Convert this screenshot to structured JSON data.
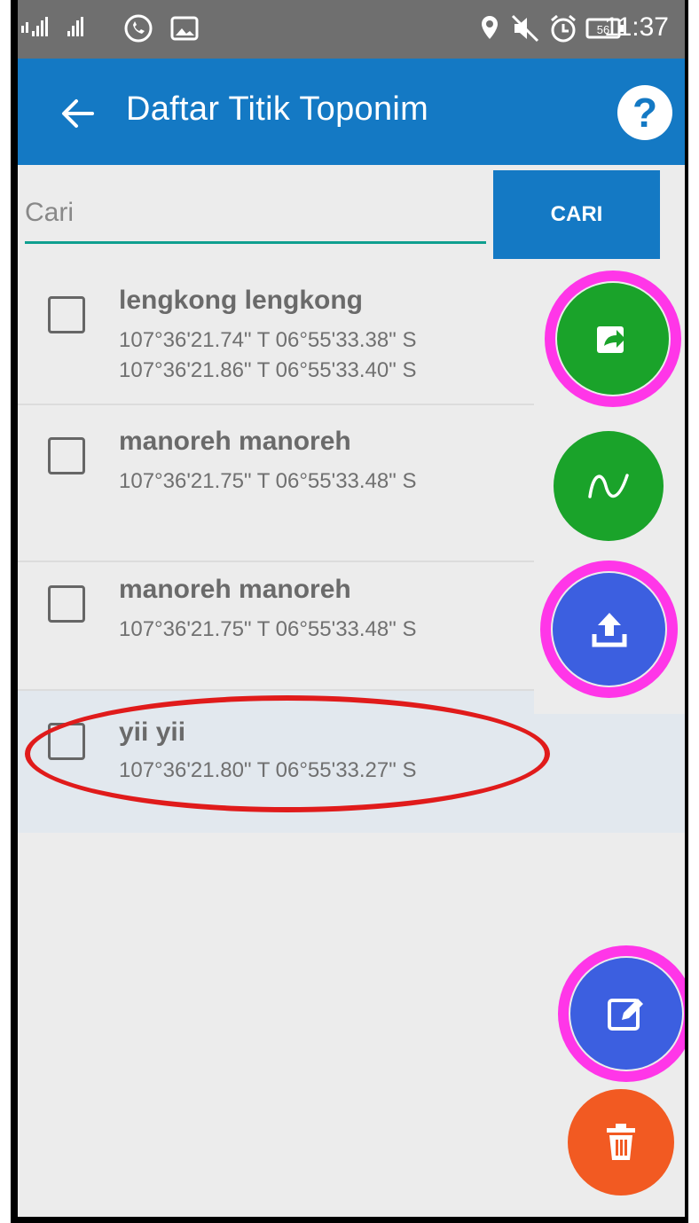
{
  "status_bar": {
    "time": "11:37",
    "icons": [
      "signal-icon",
      "whatsapp-icon",
      "gallery-icon",
      "location-icon",
      "mute-icon",
      "alarm-icon",
      "battery-icon"
    ]
  },
  "app_bar": {
    "title": "Daftar Titik Toponim",
    "help_label": "?"
  },
  "search": {
    "placeholder": "Cari",
    "button_label": "CARI"
  },
  "list": {
    "items": [
      {
        "name": "lengkong lengkong",
        "coords": [
          "107°36'21.74\" T 06°55'33.38\" S",
          "107°36'21.86\" T 06°55'33.40\" S"
        ]
      },
      {
        "name": "manoreh manoreh",
        "coords": [
          "107°36'21.75\" T 06°55'33.48\" S"
        ]
      },
      {
        "name": "manoreh manoreh",
        "coords": [
          "107°36'21.75\" T 06°55'33.48\" S"
        ]
      },
      {
        "name": "yii yii",
        "coords": [
          "107°36'21.80\" T 06°55'33.27\" S"
        ]
      }
    ]
  },
  "fabs": {
    "share_icon": "share-icon",
    "curve_icon": "curve-icon",
    "upload_icon": "upload-icon",
    "edit_icon": "edit-icon",
    "delete_icon": "trash-icon"
  },
  "colors": {
    "primary": "#1479c4",
    "green": "#1aa32a",
    "indigo": "#3c5fe0",
    "orange": "#f25a22",
    "highlight_ring": "#ff36e8",
    "annotation": "#e01b1b"
  }
}
